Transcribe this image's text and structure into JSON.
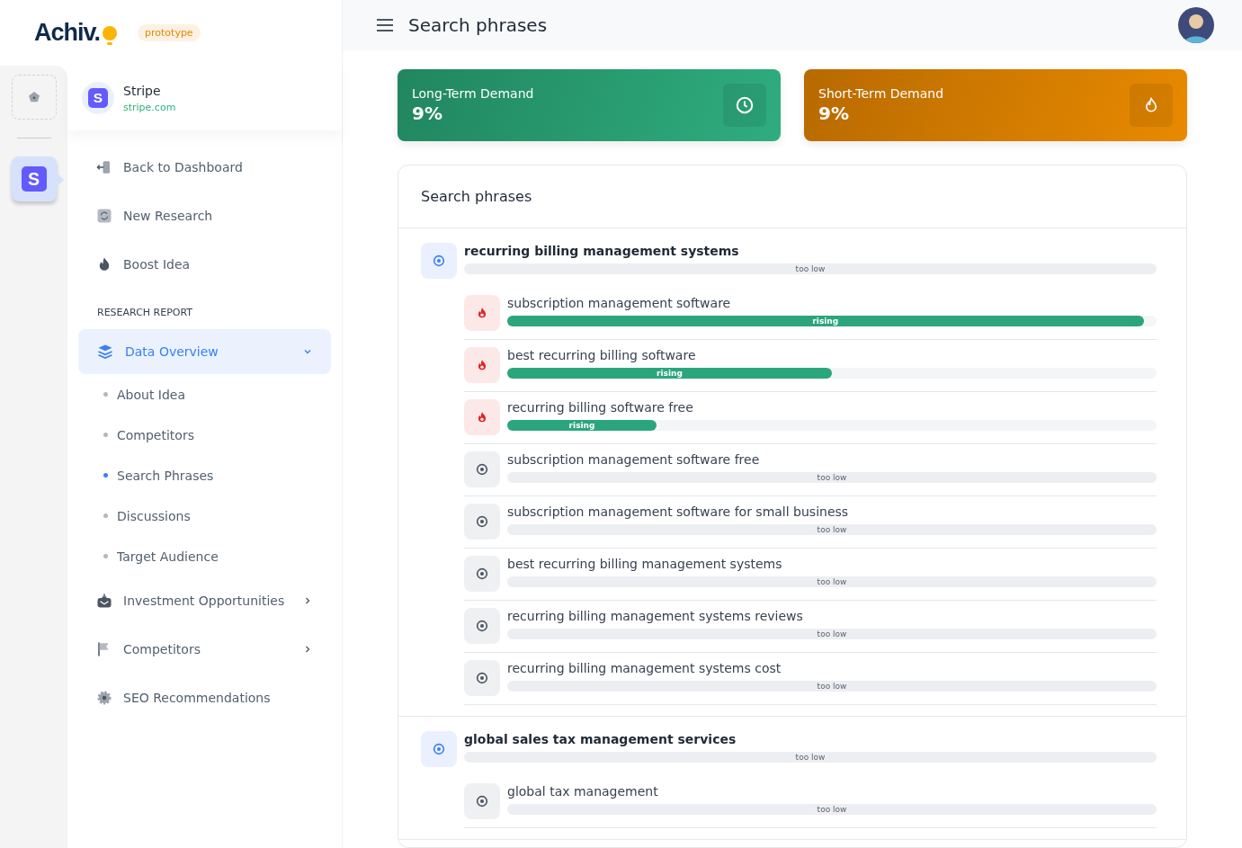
{
  "app": {
    "logo": "Achiv.",
    "badge": "prototype"
  },
  "rail": [
    {
      "kind": "placeholder",
      "selected": false
    },
    {
      "kind": "company",
      "letter": "S",
      "selected": true
    }
  ],
  "company": {
    "letter": "S",
    "name": "Stripe",
    "domain": "stripe.com"
  },
  "nav_top": [
    {
      "label": "Back to Dashboard"
    },
    {
      "label": "New Research"
    },
    {
      "label": "Boost Idea"
    }
  ],
  "section_heading": "RESEARCH REPORT",
  "menu": [
    {
      "kind": "group",
      "label": "Data Overview",
      "selected": true,
      "expanded": true,
      "children": [
        {
          "label": "About Idea",
          "selected": false
        },
        {
          "label": "Competitors",
          "selected": false
        },
        {
          "label": "Search Phrases",
          "selected": true
        },
        {
          "label": "Discussions",
          "selected": false
        },
        {
          "label": "Target Audience",
          "selected": false
        }
      ]
    },
    {
      "kind": "group",
      "label": "Investment Opportunities",
      "selected": false,
      "expanded": false
    },
    {
      "kind": "group",
      "label": "Competitors",
      "selected": false,
      "expanded": false
    },
    {
      "kind": "link",
      "label": "SEO Recommendations",
      "selected": false
    }
  ],
  "header": {
    "title": "Search phrases"
  },
  "stats": [
    {
      "kind": "long",
      "label": "Long-Term Demand",
      "value": "9%"
    },
    {
      "kind": "short",
      "label": "Short-Term Demand",
      "value": "9%"
    }
  ],
  "phrases": {
    "title": "Search phrases",
    "groups": [
      {
        "phrase": "recurring billing management systems",
        "status": "too low",
        "children": [
          {
            "phrase": "subscription management software",
            "kind": "rising",
            "status": "rising",
            "level": 0.98
          },
          {
            "phrase": "best recurring billing software",
            "kind": "rising",
            "status": "rising",
            "level": 0.5
          },
          {
            "phrase": "recurring billing software free",
            "kind": "rising",
            "status": "rising",
            "level": 0.23
          },
          {
            "phrase": "subscription management software free",
            "kind": "low",
            "status": "too low"
          },
          {
            "phrase": "subscription management software for small business",
            "kind": "low",
            "status": "too low"
          },
          {
            "phrase": "best recurring billing management systems",
            "kind": "low",
            "status": "too low"
          },
          {
            "phrase": "recurring billing management systems reviews",
            "kind": "low",
            "status": "too low"
          },
          {
            "phrase": "recurring billing management systems cost",
            "kind": "low",
            "status": "too low"
          }
        ]
      },
      {
        "phrase": "global sales tax management services",
        "status": "too low",
        "children": [
          {
            "phrase": "global tax management",
            "kind": "low",
            "status": "too low"
          }
        ]
      }
    ]
  }
}
